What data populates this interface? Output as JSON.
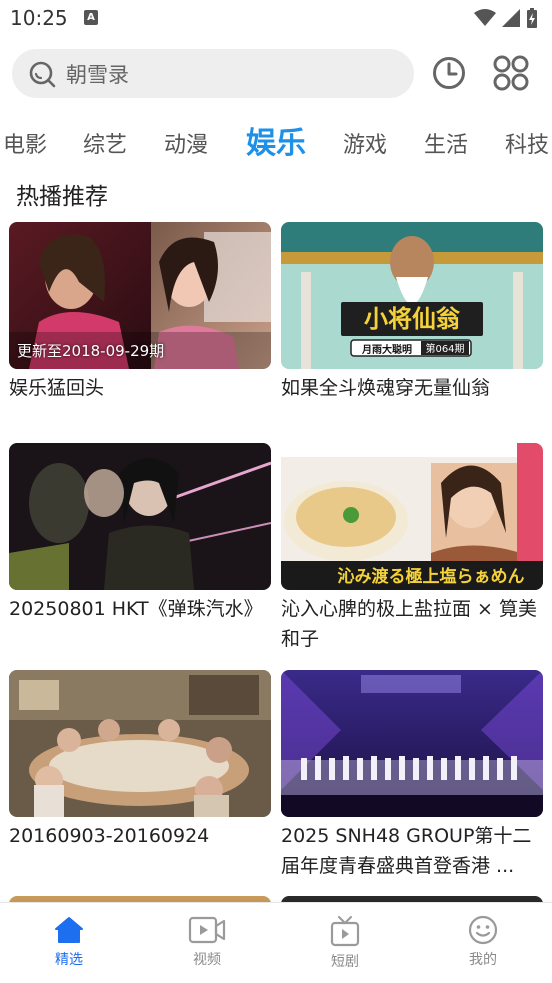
{
  "status_bar": {
    "time": "10:25",
    "notification_icon": "A"
  },
  "search": {
    "placeholder_text": "朝雪录"
  },
  "tabs": [
    {
      "label": "电影"
    },
    {
      "label": "综艺"
    },
    {
      "label": "动漫"
    },
    {
      "label": "娱乐",
      "active": true
    },
    {
      "label": "游戏"
    },
    {
      "label": "生活"
    },
    {
      "label": "科技"
    }
  ],
  "section": {
    "title": "热播推荐"
  },
  "cards": [
    {
      "title": "娱乐猛回头",
      "badge": "更新至2018-09-29期"
    },
    {
      "title": "如果全斗焕魂穿无量仙翁",
      "overlay_title": "小将仙翁",
      "overlay_sub": "月雨大聪明",
      "overlay_ep": "第064期"
    },
    {
      "title": "20250801 HKT《弹珠汽水》"
    },
    {
      "title": "沁入心脾的极上盐拉面 × 筧美和子",
      "overlay_text": "沁み渡る極上塩らぁめん"
    },
    {
      "title": "20160903-20160924"
    },
    {
      "title": "2025 SNH48 GROUP第十二届年度青春盛典首登香港 ..."
    }
  ],
  "bottom_nav": [
    {
      "label": "精选",
      "icon": "home-icon",
      "active": true
    },
    {
      "label": "视频",
      "icon": "video-icon"
    },
    {
      "label": "短剧",
      "icon": "tv-icon"
    },
    {
      "label": "我的",
      "icon": "smiley-icon"
    }
  ],
  "colors": {
    "accent": "#1e90e8",
    "nav_active": "#1e6ef0"
  }
}
